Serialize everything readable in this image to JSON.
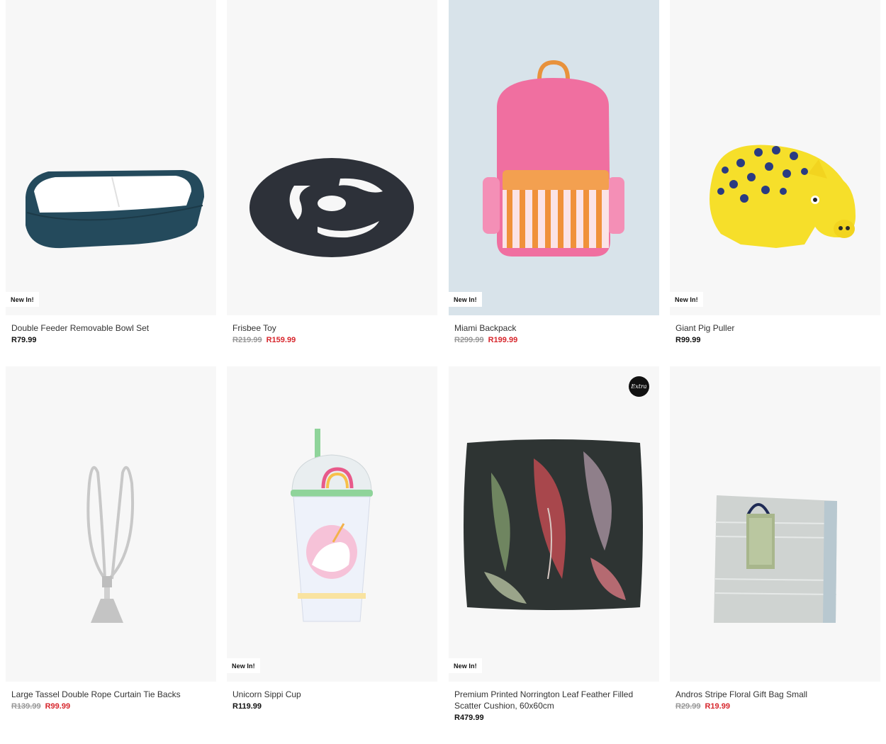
{
  "products": [
    {
      "title": "Double Feeder Removable Bowl Set",
      "badge": "New In!",
      "price": "R79.99",
      "old_price": null,
      "sale_price": null
    },
    {
      "title": "Frisbee Toy",
      "badge": null,
      "price": null,
      "old_price": "R219.99",
      "sale_price": "R159.99"
    },
    {
      "title": "Miami Backpack",
      "badge": "New In!",
      "price": null,
      "old_price": "R299.99",
      "sale_price": "R199.99"
    },
    {
      "title": "Giant Pig Puller",
      "badge": "New In!",
      "price": "R99.99",
      "old_price": null,
      "sale_price": null
    },
    {
      "title": "Large Tassel Double Rope Curtain Tie Backs",
      "badge": null,
      "price": null,
      "old_price": "R139.99",
      "sale_price": "R99.99"
    },
    {
      "title": "Unicorn Sippi Cup",
      "badge": "New In!",
      "price": "R119.99",
      "old_price": null,
      "sale_price": null
    },
    {
      "title": "Premium Printed Norrington Leaf Feather Filled Scatter Cushion, 60x60cm",
      "badge": "New In!",
      "price": "R479.99",
      "old_price": null,
      "sale_price": null,
      "extra_label": "Extra"
    },
    {
      "title": "Andros Stripe Floral Gift Bag Small",
      "badge": null,
      "price": null,
      "old_price": "R29.99",
      "sale_price": "R19.99"
    }
  ],
  "colors": {
    "sale": "#d7262c",
    "card_bg": "#f7f7f7",
    "backpack_bg": "#d8e3ea"
  }
}
